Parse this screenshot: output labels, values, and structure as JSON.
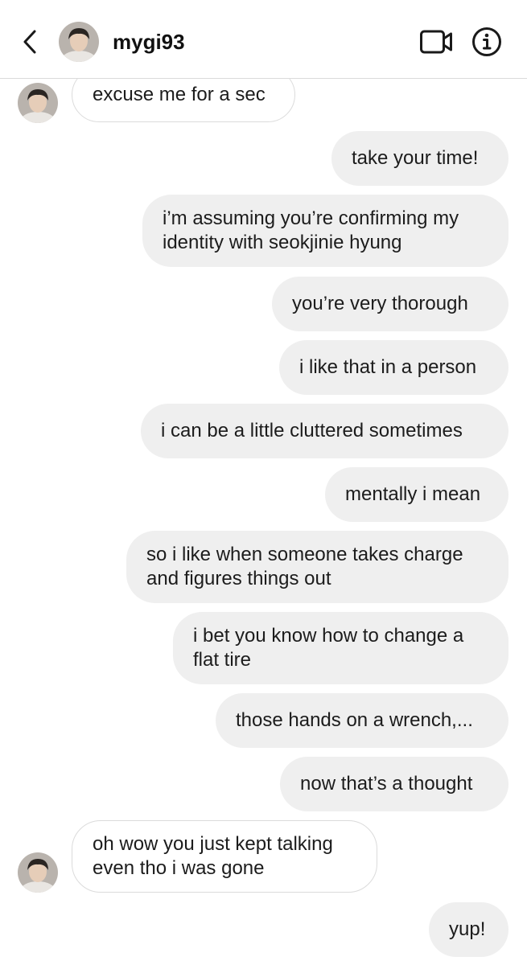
{
  "header": {
    "back_icon": "chevron-left-icon",
    "avatar_icon": "profile-photo",
    "username": "mygi93",
    "video_icon": "video-camera-icon",
    "info_icon": "info-icon"
  },
  "messages": [
    {
      "sender": "them",
      "text": "excuse me for a sec"
    },
    {
      "sender": "me",
      "text": "take your time!"
    },
    {
      "sender": "me",
      "text": "i’m assuming you’re confirming my\nidentity with seokjinie hyung"
    },
    {
      "sender": "me",
      "text": "you’re very thorough"
    },
    {
      "sender": "me",
      "text": "i like that in a person"
    },
    {
      "sender": "me",
      "text": "i can be a little cluttered sometimes"
    },
    {
      "sender": "me",
      "text": "mentally i mean"
    },
    {
      "sender": "me",
      "text": "so i like when someone takes charge\nand figures things out"
    },
    {
      "sender": "me",
      "text": "i bet you know how to change a\nflat tire"
    },
    {
      "sender": "me",
      "text": "those hands on a wrench,..."
    },
    {
      "sender": "me",
      "text": "now that’s a thought"
    },
    {
      "sender": "them",
      "text": "oh wow you just kept talking\neven tho i was gone"
    },
    {
      "sender": "me",
      "text": "yup!"
    }
  ]
}
